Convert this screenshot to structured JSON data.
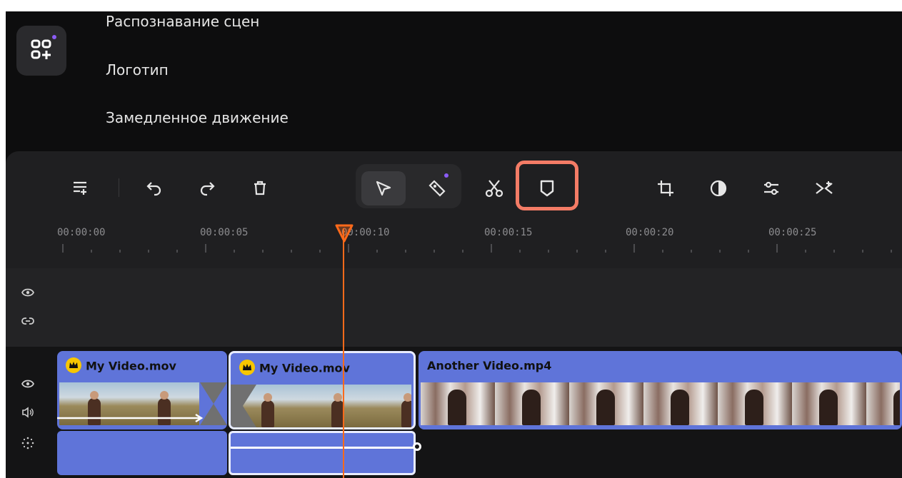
{
  "menu": {
    "items": [
      {
        "label": "Распознавание сцен"
      },
      {
        "label": "Логотип"
      },
      {
        "label": "Замедленное движение"
      }
    ]
  },
  "ruler": {
    "labels": [
      "00:00:00",
      "00:00:05",
      "00:00:10",
      "00:00:15",
      "00:00:20",
      "00:00:25"
    ]
  },
  "clips": [
    {
      "title": "My Video.mov",
      "premium": true
    },
    {
      "title": "My Video.mov",
      "premium": true
    },
    {
      "title": "Another Video.mp4",
      "premium": false
    }
  ],
  "colors": {
    "accent": "#f47c66",
    "playhead": "#ff6a1a",
    "clip": "#5f74d9",
    "new_badge": "#8b5cf6"
  },
  "toolbar": {
    "icons": [
      "add-track-icon",
      "undo-icon",
      "redo-icon",
      "delete-icon",
      "select-tool-icon",
      "marker-tool-icon",
      "cut-icon",
      "marker-icon",
      "crop-icon",
      "color-icon",
      "adjust-icon",
      "transition-icon"
    ]
  }
}
